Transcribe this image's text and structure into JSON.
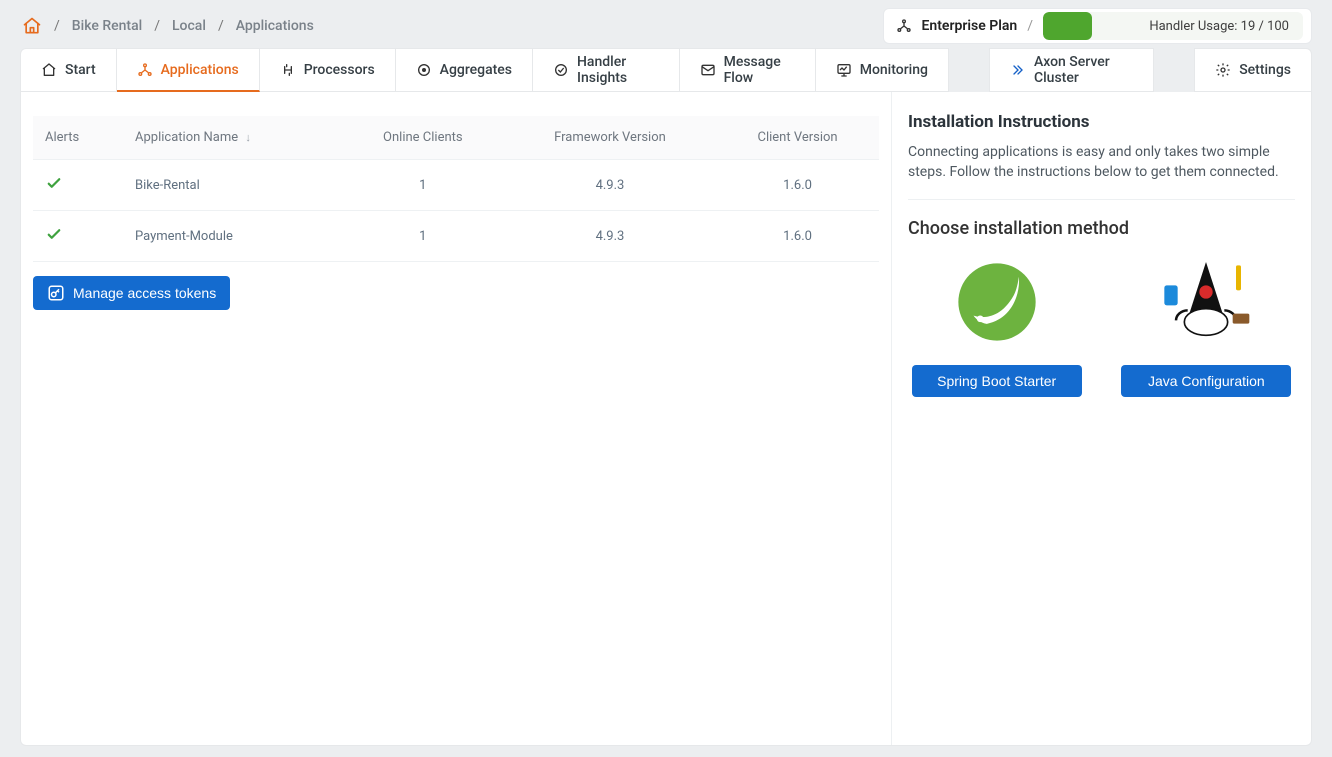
{
  "breadcrumb": {
    "items": [
      "Bike Rental",
      "Local",
      "Applications"
    ]
  },
  "plan": {
    "label": "Enterprise Plan",
    "usage_label": "Handler Usage: 19 / 100",
    "usage_percent": 19
  },
  "tabs": [
    {
      "key": "start",
      "label": "Start"
    },
    {
      "key": "applications",
      "label": "Applications"
    },
    {
      "key": "processors",
      "label": "Processors"
    },
    {
      "key": "aggregates",
      "label": "Aggregates"
    },
    {
      "key": "insights",
      "label": "Handler Insights"
    },
    {
      "key": "flow",
      "label": "Message Flow"
    },
    {
      "key": "monitoring",
      "label": "Monitoring"
    },
    {
      "key": "cluster",
      "label": "Axon Server Cluster"
    },
    {
      "key": "settings",
      "label": "Settings"
    }
  ],
  "table": {
    "headers": {
      "alerts": "Alerts",
      "name": "Application Name",
      "online": "Online Clients",
      "framework": "Framework Version",
      "client": "Client Version"
    },
    "rows": [
      {
        "alert_ok": true,
        "name": "Bike-Rental",
        "online": "1",
        "framework": "4.9.3",
        "client": "1.6.0"
      },
      {
        "alert_ok": true,
        "name": "Payment-Module",
        "online": "1",
        "framework": "4.9.3",
        "client": "1.6.0"
      }
    ]
  },
  "buttons": {
    "manage_tokens": "Manage access tokens"
  },
  "right": {
    "title": "Installation Instructions",
    "desc": "Connecting applications is easy and only takes two simple steps. Follow the instructions below to get them connected.",
    "choose": "Choose installation method",
    "methods": {
      "spring": "Spring Boot Starter",
      "java": "Java Configuration"
    }
  }
}
